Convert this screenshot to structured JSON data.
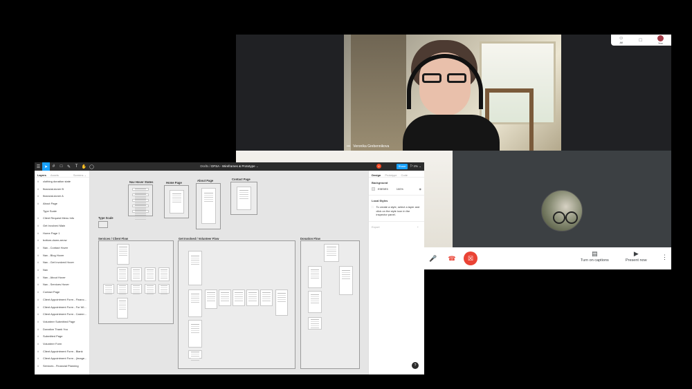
{
  "meet": {
    "topbar": [
      {
        "icon": "people-icon",
        "label": "All"
      },
      {
        "icon": "chat-icon",
        "label": ""
      },
      {
        "icon": "avatar",
        "label": "You"
      }
    ],
    "participant_name": "Veronika Grebennikova",
    "participant_more": "•••",
    "bottom": {
      "captions_label": "Turn on captions",
      "present_label": "Present now",
      "more_glyph": "⋮"
    }
  },
  "figma": {
    "breadcrumb_prefix": "Drafts",
    "file_name": "DFSA - Wireframes & Prototype",
    "file_suffix": "⌄",
    "share_label": "Share",
    "play_glyph": "▷",
    "zoom_label": "4% ⌄",
    "user_initial": "V",
    "left_tabs": {
      "layers": "Layers",
      "assets": "Assets",
      "pages": "Screens ⌄"
    },
    "layers": [
      {
        "name": "clothing donation state",
        "type": "frame"
      },
      {
        "name": "financial-doner B",
        "type": "frame"
      },
      {
        "name": "financial-doner A",
        "type": "frame"
      },
      {
        "name": "About Page",
        "type": "frame"
      },
      {
        "name": "Type Scale",
        "type": "text"
      },
      {
        "name": "Client Request Menu Info",
        "type": "frame"
      },
      {
        "name": "Get Involved Main",
        "type": "frame"
      },
      {
        "name": "Home Page 1",
        "type": "frame"
      },
      {
        "name": "bottom-down-arrow",
        "type": "frame"
      },
      {
        "name": "Nav - Contact Hover",
        "type": "frame"
      },
      {
        "name": "Nav - Blog Hover",
        "type": "frame"
      },
      {
        "name": "Nav - Get Involved Hover",
        "type": "frame"
      },
      {
        "name": "Nav",
        "type": "frame"
      },
      {
        "name": "Nav - About Hover",
        "type": "frame"
      },
      {
        "name": "Nav - Services Hover",
        "type": "frame"
      },
      {
        "name": "Contact Page",
        "type": "frame"
      },
      {
        "name": "Client Appointment Form - Financ...",
        "type": "frame"
      },
      {
        "name": "Client Appointment Form - For Wi...",
        "type": "frame"
      },
      {
        "name": "Client Appointment Form - Career...",
        "type": "frame"
      },
      {
        "name": "Volunteer Submitted Page",
        "type": "frame"
      },
      {
        "name": "Donation Thank You",
        "type": "frame"
      },
      {
        "name": "Submitted Page",
        "type": "frame"
      },
      {
        "name": "Volunteer Form",
        "type": "frame"
      },
      {
        "name": "Client Appointment Form - Blank",
        "type": "frame"
      },
      {
        "name": "Client Appointment Form - (Image...",
        "type": "frame"
      },
      {
        "name": "Services - Financial Planning",
        "type": "frame"
      }
    ],
    "canvas_labels": {
      "nav_hover": "Nav Hover States",
      "home": "Home Page",
      "about": "About Page",
      "contact": "Contact Page",
      "type_scale": "Type Scale",
      "services_flow": "Services / Client Flow",
      "volunteer_flow": "Get Involved / Volunteer Flow",
      "donation_flow": "Donation Flow"
    },
    "right_tabs": {
      "design": "Design",
      "prototype": "Prototype",
      "code": "Code"
    },
    "background": {
      "title": "Background",
      "hex": "E5E5E5",
      "opacity": "100%"
    },
    "local_styles": {
      "title": "Local Styles",
      "hint": "To create a style, select a layer and click on the style icon in the inspector panel."
    },
    "export_label": "Export",
    "help_glyph": "?"
  },
  "colors": {
    "figma_blue": "#18a0fb",
    "meet_red": "#ea4335",
    "canvas_bg": "#e5e5e5"
  }
}
